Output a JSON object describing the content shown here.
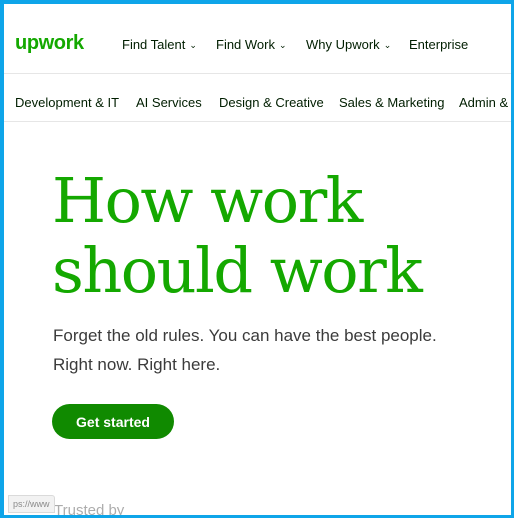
{
  "brand": {
    "logo_text": "upwork",
    "color": "#14a800"
  },
  "top_nav": {
    "items": [
      {
        "label": "Find Talent",
        "has_dropdown": true
      },
      {
        "label": "Find Work",
        "has_dropdown": true
      },
      {
        "label": "Why Upwork",
        "has_dropdown": true
      },
      {
        "label": "Enterprise",
        "has_dropdown": false
      }
    ],
    "dropdown_icon": "chevron-down-icon"
  },
  "category_nav": {
    "items": [
      "Development & IT",
      "AI Services",
      "Design & Creative",
      "Sales & Marketing",
      "Admin & C"
    ]
  },
  "hero": {
    "title_line1": "How work",
    "title_line2": "should work",
    "subtitle_line1": "Forget the old rules. You can have the best people.",
    "subtitle_line2": "Right now. Right here.",
    "cta_label": "Get started",
    "cta_color": "#108a00"
  },
  "trusted_label": "Trusted by",
  "status_bar": {
    "url_fragment": "ps://www"
  },
  "frame_color": "#0ea5e9"
}
